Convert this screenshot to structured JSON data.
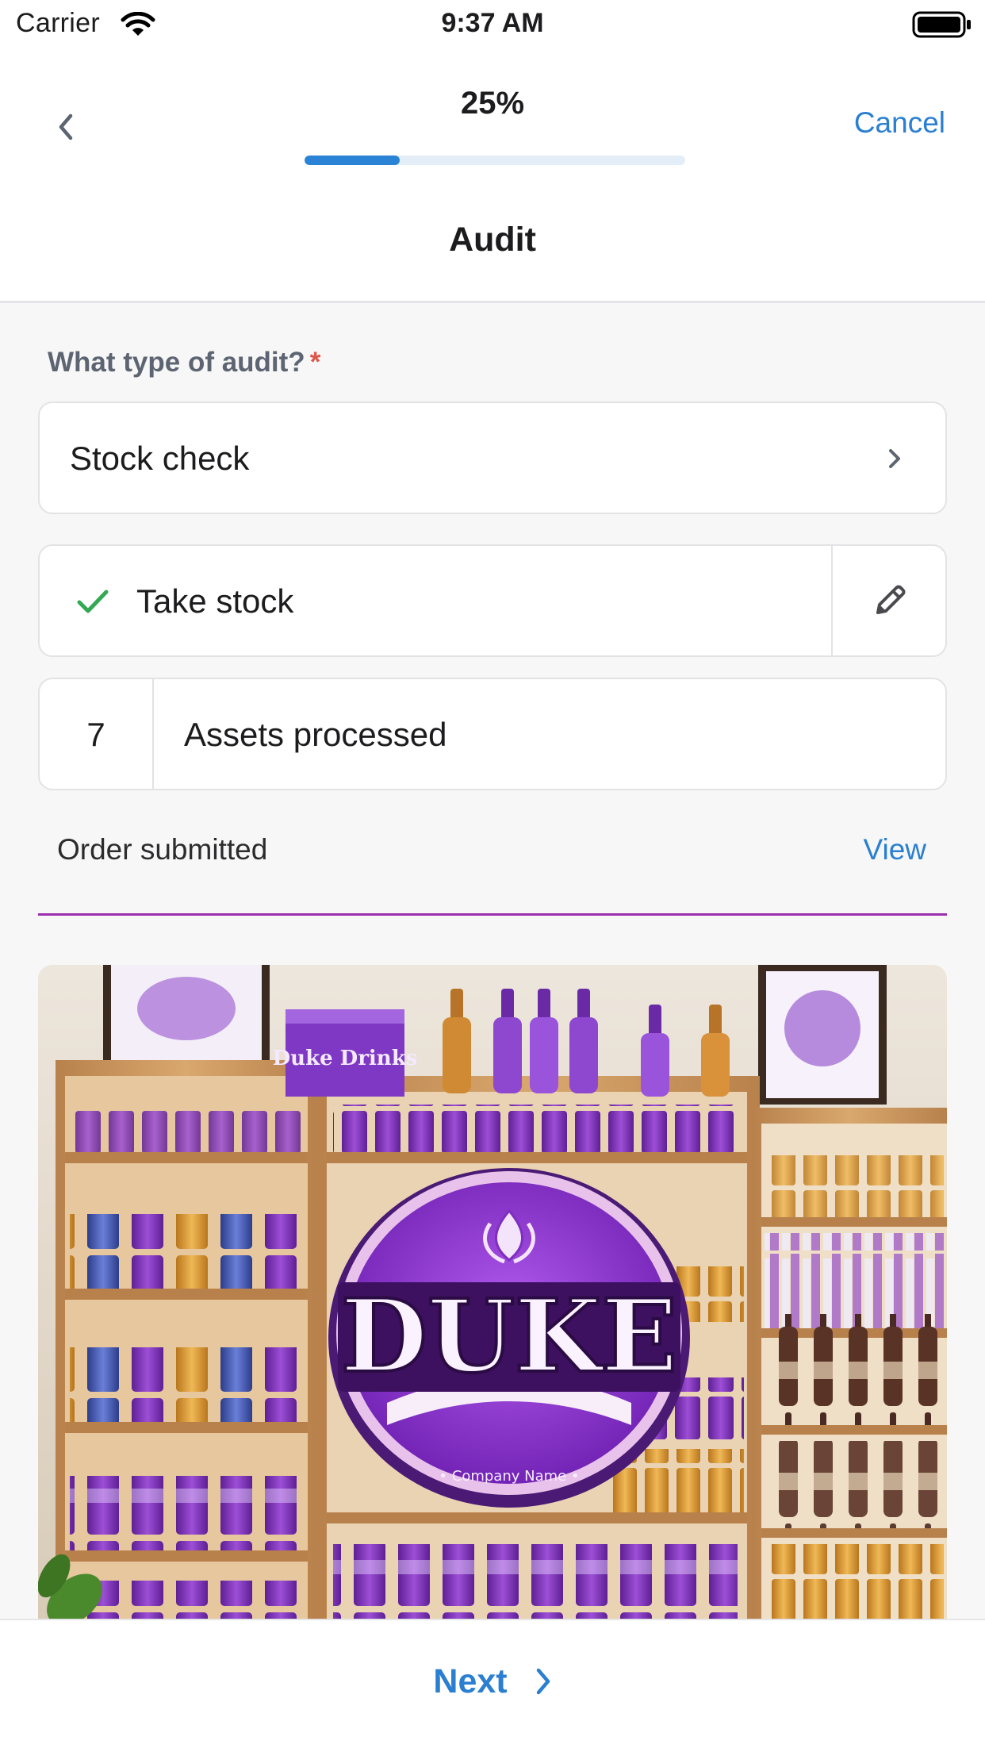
{
  "status_bar": {
    "carrier": "Carrier",
    "time": "9:37 AM",
    "icons": [
      "wifi-icon",
      "battery-icon"
    ]
  },
  "header": {
    "progress_text": "25%",
    "progress_fraction": 0.25,
    "cancel_label": "Cancel",
    "title": "Audit",
    "back_icon": "chevron-left-icon"
  },
  "form": {
    "audit_type": {
      "question": "What type of audit?",
      "required_mark": "*",
      "value": "Stock check",
      "icon": "chevron-right-icon"
    },
    "task": {
      "label": "Take stock",
      "status_icon": "checkmark-icon",
      "action_icon": "pencil-icon"
    },
    "assets": {
      "count": "7",
      "label": "Assets processed"
    },
    "order": {
      "label": "Order submitted",
      "link": "View"
    }
  },
  "photo": {
    "sign_text": "DUKE",
    "sign_subtext": "• Company Name •",
    "box_text": "Duke Drinks"
  },
  "footer": {
    "next_label": "Next",
    "next_icon": "chevron-right-icon"
  },
  "colors": {
    "accent": "#2a7fd0",
    "progress": "#2b83d6",
    "success": "#34a853",
    "required": "#e0534a",
    "divider_purple": "#9c2fae",
    "brand_purple": "#8a2fc0"
  }
}
